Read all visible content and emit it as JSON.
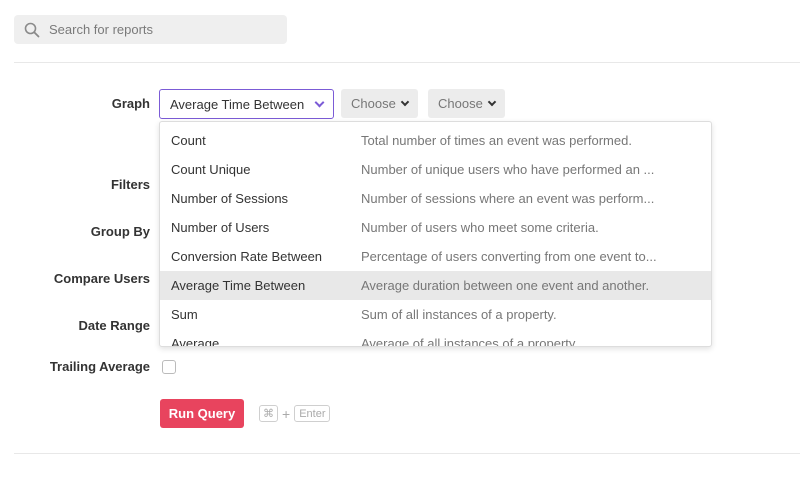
{
  "search": {
    "placeholder": "Search for reports"
  },
  "form": {
    "labels": {
      "graph": "Graph",
      "filters": "Filters",
      "group_by": "Group By",
      "compare_users": "Compare Users",
      "date_range": "Date Range",
      "trailing_average": "Trailing Average"
    },
    "graph_select": {
      "value": "Average Time Between"
    },
    "choose_1": "Choose",
    "choose_2": "Choose",
    "trailing_average_checked": false
  },
  "dropdown": {
    "items": [
      {
        "name": "Count",
        "description": "Total number of times an event was performed."
      },
      {
        "name": "Count Unique",
        "description": "Number of unique users who have performed an ..."
      },
      {
        "name": "Number of Sessions",
        "description": "Number of sessions where an event was perform..."
      },
      {
        "name": "Number of Users",
        "description": "Number of users who meet some criteria."
      },
      {
        "name": "Conversion Rate Between",
        "description": "Percentage of users converting from one event to..."
      },
      {
        "name": "Average Time Between",
        "description": "Average duration between one event and another."
      },
      {
        "name": "Sum",
        "description": "Sum of all instances of a property."
      },
      {
        "name": "Average",
        "description": "Average of all instances of a property."
      }
    ],
    "selected": "Average Time Between"
  },
  "actions": {
    "run_query": "Run Query",
    "shortcut_cmd": "⌘",
    "shortcut_plus": "+",
    "shortcut_enter": "Enter"
  },
  "colors": {
    "accent_purple": "#7b5bd6",
    "run_button": "#e8445e",
    "selected_row": "#e8e8e8"
  }
}
